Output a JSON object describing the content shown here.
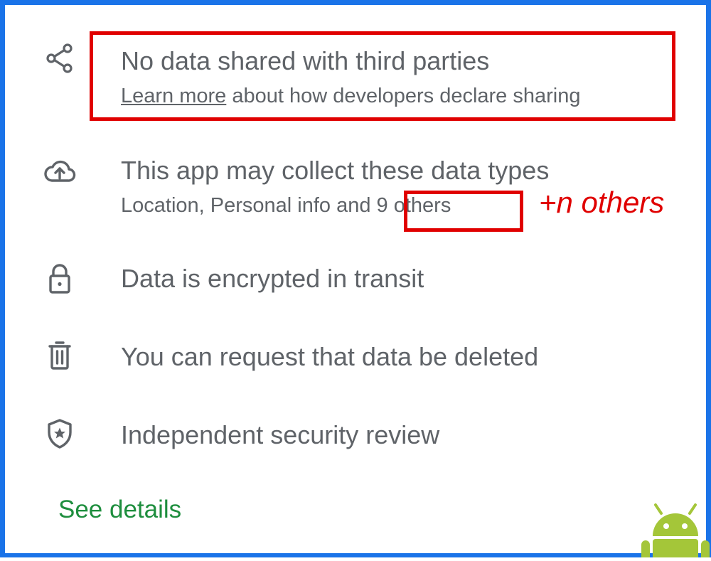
{
  "items": [
    {
      "icon": "share-icon",
      "title": "No data shared with third parties",
      "subtitle_link": "Learn more",
      "subtitle_rest": "about how developers declare sharing"
    },
    {
      "icon": "cloud-upload-icon",
      "title": "This app may collect these data types",
      "subtitle_prefix": "Location, Personal info and ",
      "subtitle_count": "9 others"
    },
    {
      "icon": "lock-icon",
      "title": "Data is encrypted in transit"
    },
    {
      "icon": "trash-icon",
      "title": "You can request that data be deleted"
    },
    {
      "icon": "shield-star-icon",
      "title": "Independent security review"
    }
  ],
  "annotation": "+n others",
  "see_details": "See details",
  "logo": "android-robot-icon",
  "colors": {
    "frame": "#1a73e8",
    "annotation": "#e00000",
    "text": "#5f6368",
    "link_green": "#1e8e3e",
    "android_green": "#a4c639"
  }
}
